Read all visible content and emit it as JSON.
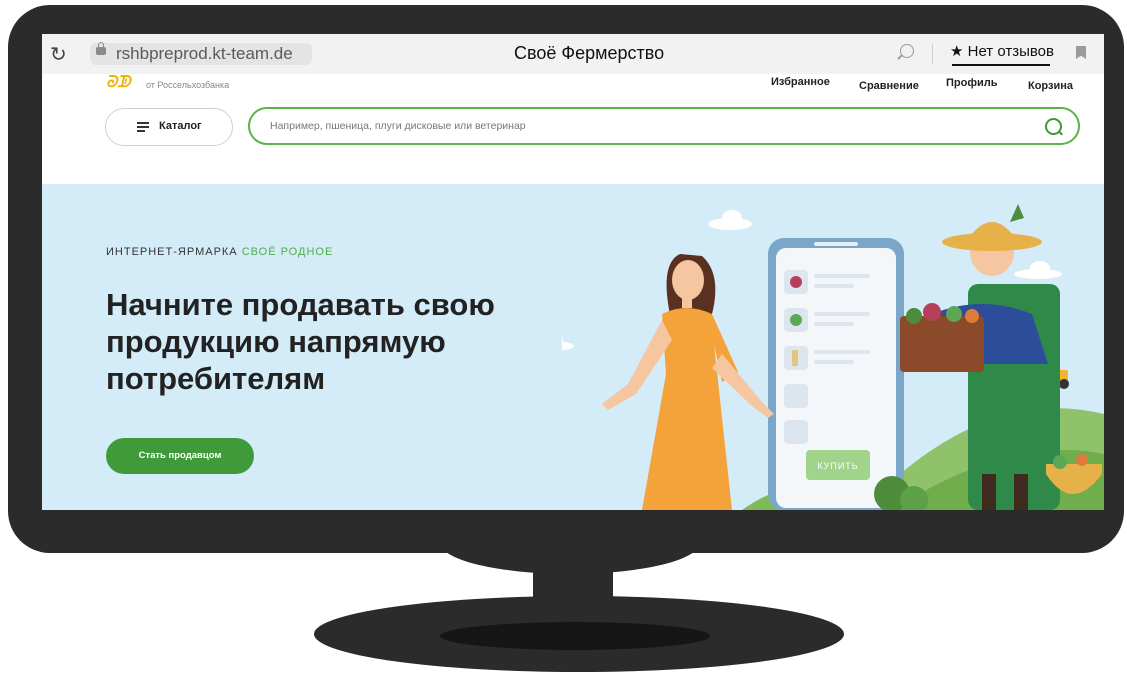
{
  "browser": {
    "url": "rshbpreprod.kt-team.de",
    "title": "Своё Фермерство",
    "reviews_label": "★ Нет отзывов"
  },
  "header": {
    "logo_subtitle": "от Россельхозбанка",
    "nav": {
      "favorites": "Избранное",
      "compare": "Сравнение",
      "profile": "Профиль",
      "cart": "Корзина"
    },
    "catalog_label": "Каталог",
    "search_placeholder": "Например, пшеница, плуги дисковые или ветеринар"
  },
  "hero": {
    "eyebrow_main": "ИНТЕРНЕТ-ЯРМАРКА",
    "eyebrow_accent": "СВОЁ РОДНОЕ",
    "headline": "Начните продавать свою продукцию напрямую потребителям",
    "cta_label": "Стать продавцом",
    "phone_buy_label": "КУПИТЬ"
  },
  "colors": {
    "brand_green": "#3f9a3a",
    "hero_bg": "#d4ebf8",
    "bezel": "#2b2b2b"
  }
}
